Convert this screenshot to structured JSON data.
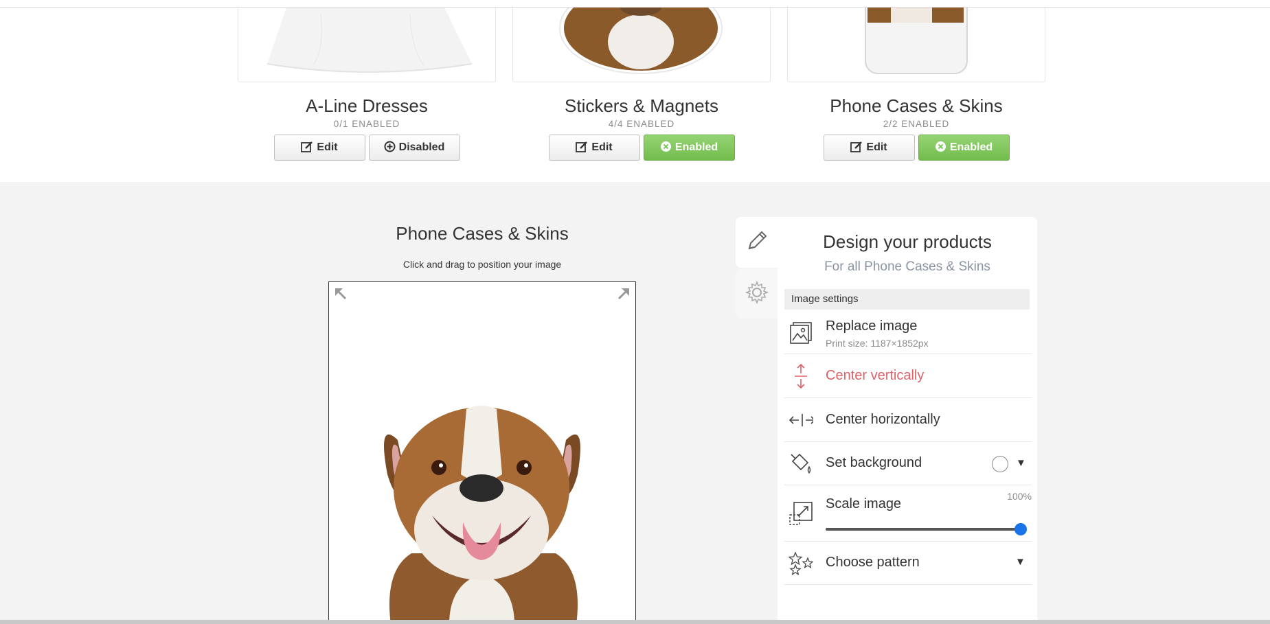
{
  "products": [
    {
      "title": "A-Line Dresses",
      "status": "0/1 ENABLED",
      "edit_label": "Edit",
      "toggle_label": "Disabled",
      "enabled": false
    },
    {
      "title": "Stickers & Magnets",
      "status": "4/4 ENABLED",
      "edit_label": "Edit",
      "toggle_label": "Enabled",
      "enabled": true
    },
    {
      "title": "Phone Cases & Skins",
      "status": "2/2 ENABLED",
      "edit_label": "Edit",
      "toggle_label": "Enabled",
      "enabled": true
    }
  ],
  "preview": {
    "title": "Phone Cases & Skins",
    "hint": "Click and drag to position your image"
  },
  "panel": {
    "title": "Design your products",
    "subtitle": "For all Phone Cases & Skins",
    "section": "Image settings",
    "replace": {
      "label": "Replace image",
      "sub": "Print size: 1187×1852px"
    },
    "center_v": {
      "label": "Center vertically"
    },
    "center_h": {
      "label": "Center horizontally"
    },
    "background": {
      "label": "Set background"
    },
    "scale": {
      "label": "Scale image",
      "value": "100%",
      "fraction": 1.0
    },
    "pattern": {
      "label": "Choose pattern"
    }
  },
  "icons": {
    "edit": "edit-icon",
    "disabled": "plus-circle-icon",
    "enabled": "x-circle-icon",
    "tab_design": "pencil-icon",
    "tab_settings": "gear-icon"
  },
  "colors": {
    "enabled_green": "#7cc457",
    "accent_red": "#e06068",
    "slider_blue": "#1a73e8"
  }
}
